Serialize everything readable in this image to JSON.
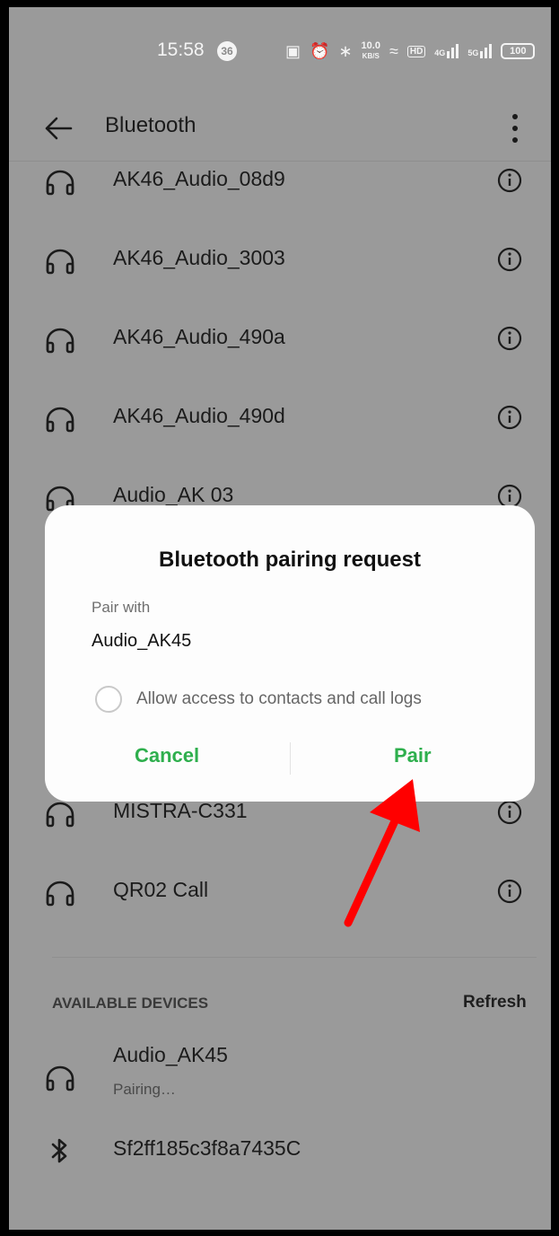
{
  "status_bar": {
    "time": "15:58",
    "badge": "36",
    "speed_value": "10.0",
    "speed_unit": "KB/S",
    "hd_label": "HD",
    "net1": "4G",
    "net2": "5G",
    "battery": "100"
  },
  "app_bar": {
    "title": "Bluetooth"
  },
  "paired_devices": [
    {
      "name": "AK46_Audio_08d9",
      "icon": "headphones-icon"
    },
    {
      "name": "AK46_Audio_3003",
      "icon": "headphones-icon"
    },
    {
      "name": "AK46_Audio_490a",
      "icon": "headphones-icon"
    },
    {
      "name": "AK46_Audio_490d",
      "icon": "headphones-icon"
    },
    {
      "name": "Audio_AK 03",
      "icon": "headphones-icon"
    },
    {
      "name": "MISTRA-C331",
      "icon": "headphones-icon"
    },
    {
      "name": "QR02 Call",
      "icon": "headphones-icon"
    }
  ],
  "available_section": {
    "title": "AVAILABLE DEVICES",
    "refresh_label": "Refresh",
    "devices": [
      {
        "name": "Audio_AK45",
        "status": "Pairing…",
        "icon": "headphones-icon"
      },
      {
        "name": "Sf2ff185c3f8a7435C",
        "icon": "bluetooth-icon"
      }
    ]
  },
  "dialog": {
    "title": "Bluetooth pairing request",
    "pair_with_label": "Pair with",
    "device_name": "Audio_AK45",
    "checkbox_label": "Allow access to contacts and call logs",
    "checkbox_checked": false,
    "cancel_label": "Cancel",
    "pair_label": "Pair"
  },
  "colors": {
    "accent": "#2eaf4d",
    "annotation_arrow": "#ff0000",
    "scrim_background": "#9a9a9a"
  }
}
